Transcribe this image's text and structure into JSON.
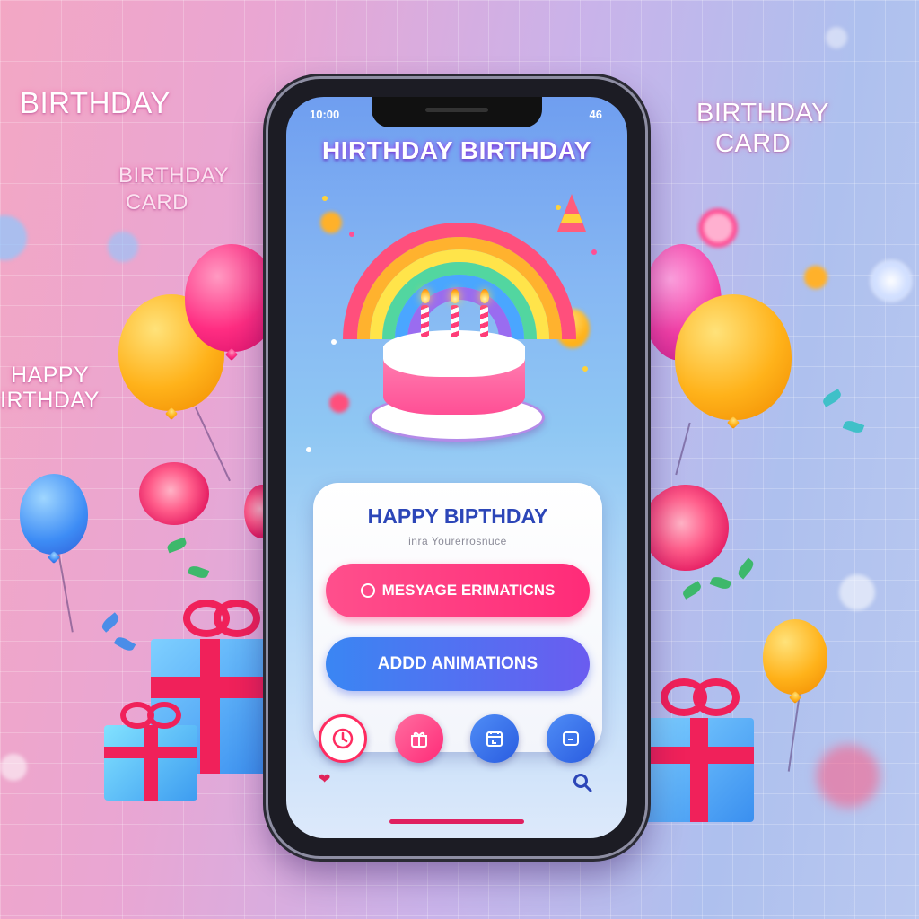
{
  "background": {
    "labels": [
      {
        "text": "BIRTHDAY",
        "name": "bg-label-birthday-left"
      },
      {
        "text": "BIRTHDAY",
        "name": "bg-label-birthday-card-left-1"
      },
      {
        "text": "CARD",
        "name": "bg-label-birthday-card-left-2"
      },
      {
        "text": "HAPPY",
        "name": "bg-label-happy-birthday-1"
      },
      {
        "text": "IRTHDAY",
        "name": "bg-label-happy-birthday-2"
      },
      {
        "text": "BIRTHDAY",
        "name": "bg-label-birthday-card-right-1"
      },
      {
        "text": "CARD",
        "name": "bg-label-birthday-card-right-2"
      }
    ]
  },
  "status_bar": {
    "time": "10:00",
    "right": "46"
  },
  "app": {
    "title": "HIRTHDAY BIRTHDAY",
    "card": {
      "title": "HAPPY BIPTHDAY",
      "subtitle": "inra Yourerrosnuce",
      "primary_button": "MESYAGE ERIMATICNS",
      "secondary_button": "ADDD ANIMATIONS"
    },
    "bottom_icons": [
      "clock-icon",
      "gift-icon",
      "calendar-icon",
      "frame-icon"
    ]
  },
  "colors": {
    "accent_pink": "#ff2b78",
    "accent_blue": "#3a86f3",
    "title_blue": "#2c46b8"
  }
}
